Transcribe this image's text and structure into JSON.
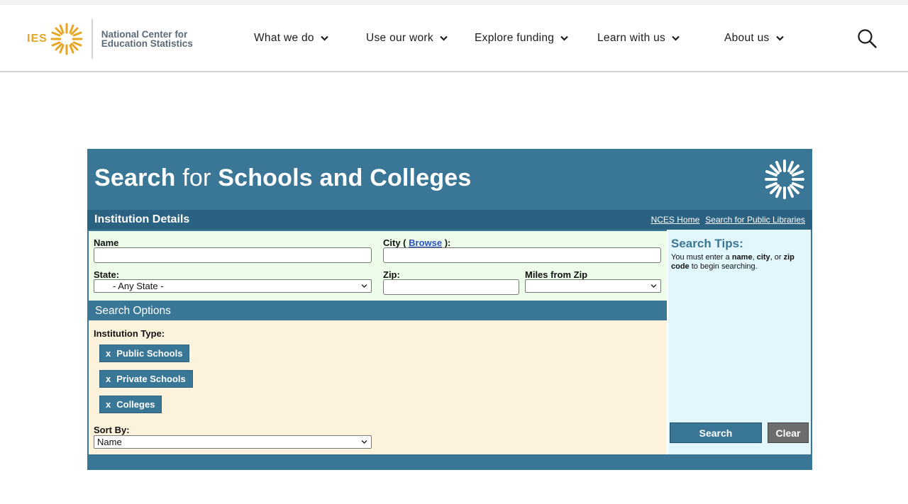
{
  "header": {
    "logo_ies": "IES",
    "logo_line1": "National Center for",
    "logo_line2": "Education Statistics",
    "nav": [
      {
        "label": "What we do"
      },
      {
        "label": "Use our work"
      },
      {
        "label": "Explore funding"
      },
      {
        "label": "Learn with us"
      },
      {
        "label": "About us"
      }
    ]
  },
  "panel": {
    "title_bold_1": "Search",
    "title_light": "for",
    "title_bold_2": "Schools and Colleges",
    "section_details": "Institution Details",
    "links": [
      "NCES Home",
      "Search for Public Libraries"
    ],
    "form": {
      "name_label": "Name",
      "name_value": "",
      "city_label_prefix": "City (",
      "city_browse": "Browse",
      "city_label_suffix": "):",
      "city_value": "",
      "state_label": "State:",
      "state_value": "- Any State -",
      "zip_label": "Zip:",
      "zip_value": "",
      "miles_label": "Miles from Zip",
      "miles_value": ""
    },
    "section_options": "Search Options",
    "institution_type_label": "Institution Type:",
    "institution_types": [
      "Public Schools",
      "Private Schools",
      "Colleges"
    ],
    "chip_remove": "x",
    "sort_label": "Sort By:",
    "sort_value": "Name",
    "tips": {
      "title": "Search Tips:",
      "text_1": "You must enter a ",
      "bold_name": "name",
      "sep_1": ", ",
      "bold_city": "city",
      "sep_2": ", or ",
      "bold_zip": "zip code",
      "text_2": " to begin searching."
    },
    "search_button": "Search",
    "clear_button": "Clear"
  },
  "colors": {
    "brand_blue": "#3a7695",
    "dark_blue": "#2c6281",
    "ies_gold": "#e8a524",
    "details_bg": "#eefde9",
    "options_bg": "#fdf3dd",
    "tips_bg": "#e2f6fd"
  }
}
